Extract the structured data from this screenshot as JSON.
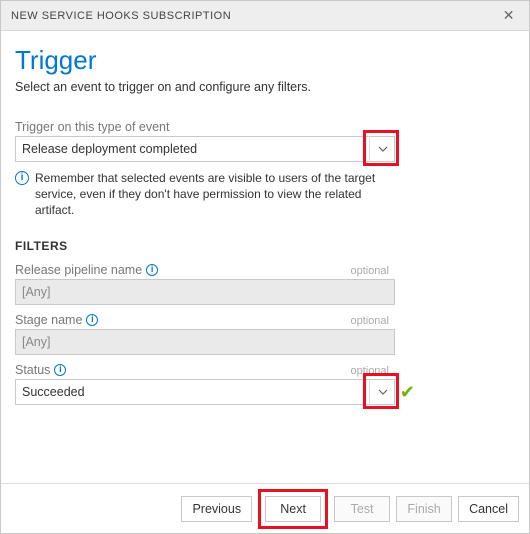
{
  "titlebar": {
    "title": "NEW SERVICE HOOKS SUBSCRIPTION"
  },
  "page": {
    "heading": "Trigger",
    "subtitle": "Select an event to trigger on and configure any filters."
  },
  "event": {
    "label": "Trigger on this type of event",
    "value": "Release deployment completed",
    "note": "Remember that selected events are visible to users of the target service, even if they don't have permission to view the related artifact."
  },
  "filters": {
    "heading": "FILTERS",
    "optional": "optional",
    "pipeline": {
      "label": "Release pipeline name",
      "value": "[Any]"
    },
    "stage": {
      "label": "Stage name",
      "value": "[Any]"
    },
    "status": {
      "label": "Status",
      "value": "Succeeded"
    }
  },
  "footer": {
    "previous": "Previous",
    "next": "Next",
    "test": "Test",
    "finish": "Finish",
    "cancel": "Cancel"
  }
}
